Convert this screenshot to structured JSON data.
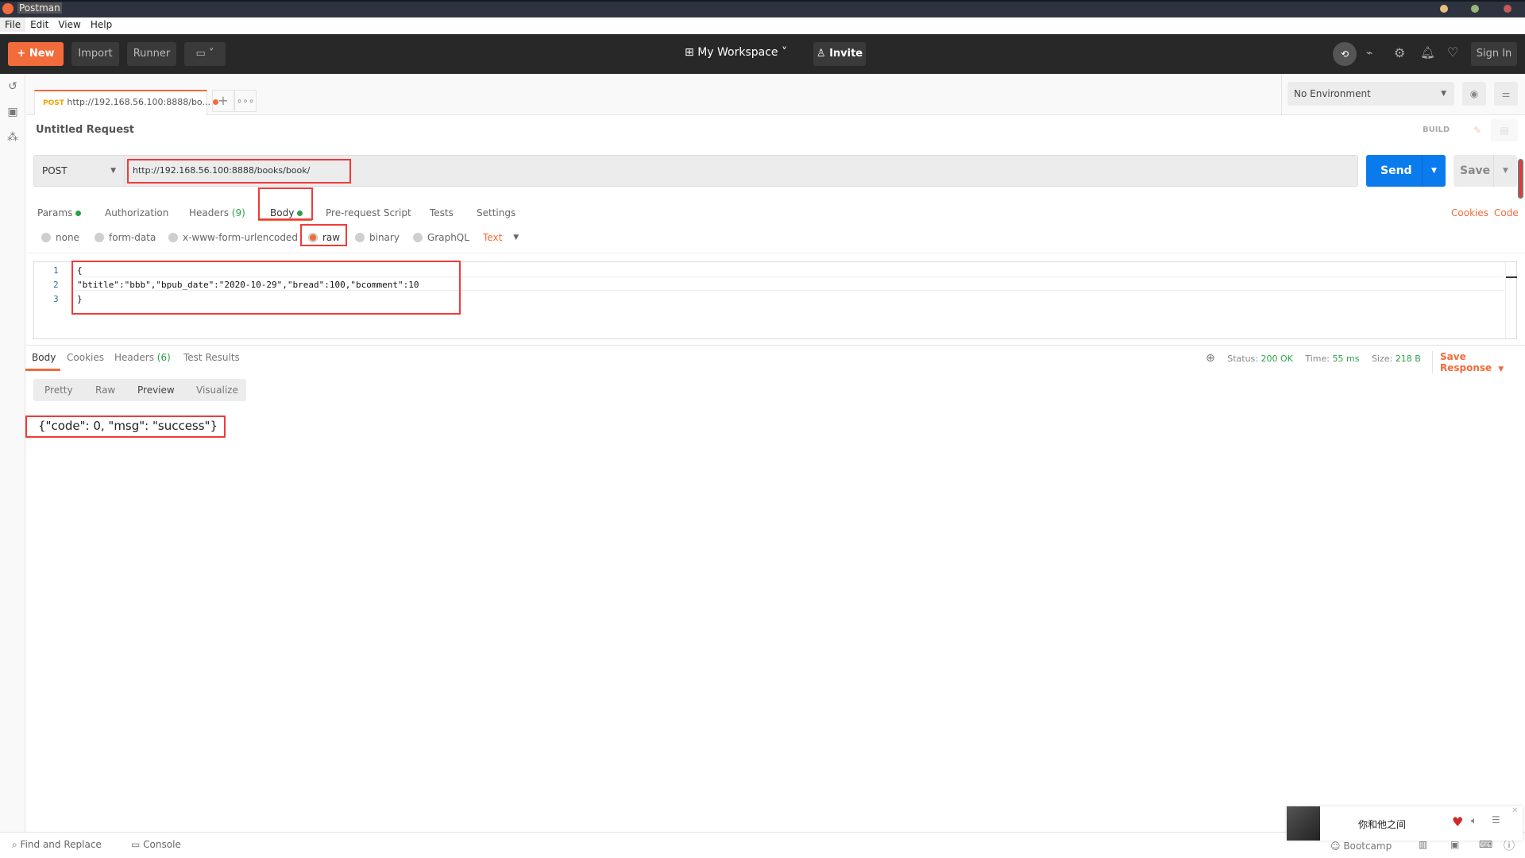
{
  "window": {
    "title": "Postman",
    "controls": [
      "minimize",
      "maximize",
      "close"
    ]
  },
  "menu": [
    "File",
    "Edit",
    "View",
    "Help"
  ],
  "toolbar": {
    "new": "New",
    "import": "Import",
    "runner": "Runner",
    "workspace": "My Workspace",
    "invite": "Invite",
    "sign_in": "Sign In"
  },
  "tab": {
    "method": "POST",
    "title": "http://192.168.56.100:8888/bo..."
  },
  "environment": {
    "selected": "No Environment"
  },
  "request": {
    "name": "Untitled Request",
    "mode": "BUILD",
    "method": "POST",
    "url": "http://192.168.56.100:8888/books/book/",
    "send": "Send",
    "save": "Save"
  },
  "req_tabs": [
    {
      "label": "Params"
    },
    {
      "label": "Authorization"
    },
    {
      "label": "Headers",
      "count": "(9)"
    },
    {
      "label": "Body"
    },
    {
      "label": "Pre-request Script"
    },
    {
      "label": "Tests"
    },
    {
      "label": "Settings"
    }
  ],
  "req_links": {
    "cookies": "Cookies",
    "code": "Code"
  },
  "body_types": [
    "none",
    "form-data",
    "x-www-form-urlencoded",
    "raw",
    "binary",
    "GraphQL"
  ],
  "body_selected": "raw",
  "body_format": "Text",
  "editor": {
    "lines": [
      "1",
      "2",
      "3"
    ],
    "code": [
      "{",
      "\"btitle\":\"bbb\",\"bpub_date\":\"2020-10-29\",\"bread\":100,\"bcomment\":10",
      "}"
    ]
  },
  "response": {
    "tabs": [
      {
        "label": "Body"
      },
      {
        "label": "Cookies"
      },
      {
        "label": "Headers",
        "count": "(6)"
      },
      {
        "label": "Test Results"
      }
    ],
    "status_label": "Status:",
    "status": "200 OK",
    "time_label": "Time:",
    "time": "55 ms",
    "size_label": "Size:",
    "size": "218 B",
    "save": "Save Response",
    "views": [
      "Pretty",
      "Raw",
      "Preview",
      "Visualize"
    ],
    "body": "{\"code\": 0, \"msg\": \"success\"}"
  },
  "footer": {
    "find": "Find and Replace",
    "console": "Console",
    "bootcamp": "Bootcamp"
  },
  "music": {
    "song": "你和他之间"
  },
  "colors": {
    "accent": "#f26b3a",
    "send": "#097bed",
    "success": "#2aa14b",
    "annotation": "#f03a3a"
  }
}
